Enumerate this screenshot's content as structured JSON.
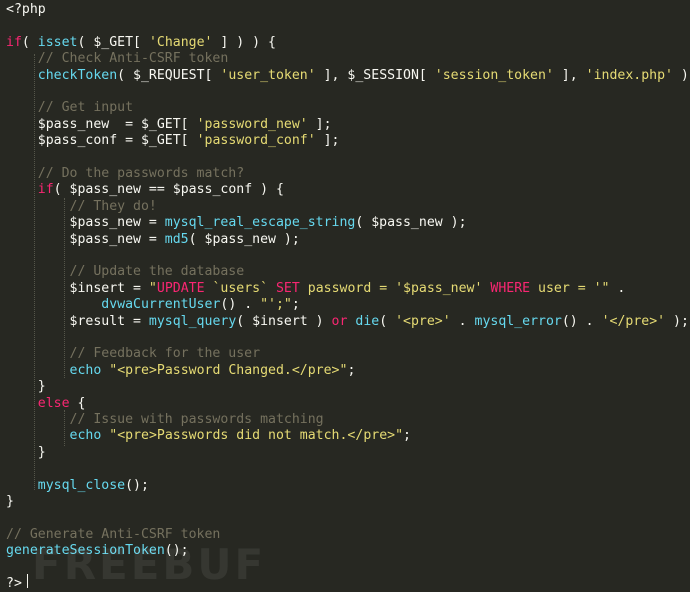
{
  "colors": {
    "background": "#272822",
    "default": "#f8f8f2",
    "keyword": "#f92672",
    "function": "#66d9ef",
    "string": "#e6db74",
    "comment": "#75715e"
  },
  "watermark": "FREEBUF",
  "lines": [
    [
      {
        "t": "<?php",
        "c": "default"
      }
    ],
    [],
    [
      {
        "t": "if",
        "c": "keyword"
      },
      {
        "t": "( ",
        "c": "default"
      },
      {
        "t": "isset",
        "c": "func"
      },
      {
        "t": "( $_GET[ ",
        "c": "default"
      },
      {
        "t": "'Change'",
        "c": "string"
      },
      {
        "t": " ] ) ) {",
        "c": "default"
      }
    ],
    [
      {
        "t": "    // Check Anti-CSRF token",
        "c": "comment"
      }
    ],
    [
      {
        "t": "    ",
        "c": "default"
      },
      {
        "t": "checkToken",
        "c": "func"
      },
      {
        "t": "( $_REQUEST[ ",
        "c": "default"
      },
      {
        "t": "'user_token'",
        "c": "string"
      },
      {
        "t": " ], $_SESSION[ ",
        "c": "default"
      },
      {
        "t": "'session_token'",
        "c": "string"
      },
      {
        "t": " ], ",
        "c": "default"
      },
      {
        "t": "'index.php'",
        "c": "string"
      },
      {
        "t": " );",
        "c": "default"
      }
    ],
    [],
    [
      {
        "t": "    // Get input",
        "c": "comment"
      }
    ],
    [
      {
        "t": "    $pass_new  = $_GET[ ",
        "c": "default"
      },
      {
        "t": "'password_new'",
        "c": "string"
      },
      {
        "t": " ];",
        "c": "default"
      }
    ],
    [
      {
        "t": "    $pass_conf = $_GET[ ",
        "c": "default"
      },
      {
        "t": "'password_conf'",
        "c": "string"
      },
      {
        "t": " ];",
        "c": "default"
      }
    ],
    [],
    [
      {
        "t": "    // Do the passwords match?",
        "c": "comment"
      }
    ],
    [
      {
        "t": "    ",
        "c": "default"
      },
      {
        "t": "if",
        "c": "keyword"
      },
      {
        "t": "( $pass_new == $pass_conf ) {",
        "c": "default"
      }
    ],
    [
      {
        "t": "        // They do!",
        "c": "comment"
      }
    ],
    [
      {
        "t": "        $pass_new = ",
        "c": "default"
      },
      {
        "t": "mysql_real_escape_string",
        "c": "func"
      },
      {
        "t": "( $pass_new );",
        "c": "default"
      }
    ],
    [
      {
        "t": "        $pass_new = ",
        "c": "default"
      },
      {
        "t": "md5",
        "c": "func"
      },
      {
        "t": "( $pass_new );",
        "c": "default"
      }
    ],
    [],
    [
      {
        "t": "        // Update the database",
        "c": "comment"
      }
    ],
    [
      {
        "t": "        $insert = ",
        "c": "default"
      },
      {
        "t": "\"",
        "c": "string"
      },
      {
        "t": "UPDATE",
        "c": "keyword"
      },
      {
        "t": " `users` ",
        "c": "string"
      },
      {
        "t": "SET",
        "c": "keyword"
      },
      {
        "t": " password = '$pass_new' ",
        "c": "string"
      },
      {
        "t": "WHERE",
        "c": "keyword"
      },
      {
        "t": " user = '\"",
        "c": "string"
      },
      {
        "t": " .",
        "c": "default"
      }
    ],
    [
      {
        "t": "            ",
        "c": "default"
      },
      {
        "t": "dvwaCurrentUser",
        "c": "func"
      },
      {
        "t": "() . ",
        "c": "default"
      },
      {
        "t": "\"';\"",
        "c": "string"
      },
      {
        "t": ";",
        "c": "default"
      }
    ],
    [
      {
        "t": "        $result = ",
        "c": "default"
      },
      {
        "t": "mysql_query",
        "c": "func"
      },
      {
        "t": "( $insert ) ",
        "c": "default"
      },
      {
        "t": "or",
        "c": "keyword"
      },
      {
        "t": " ",
        "c": "default"
      },
      {
        "t": "die",
        "c": "func"
      },
      {
        "t": "( ",
        "c": "default"
      },
      {
        "t": "'<pre>'",
        "c": "string"
      },
      {
        "t": " . ",
        "c": "default"
      },
      {
        "t": "mysql_error",
        "c": "func"
      },
      {
        "t": "() . ",
        "c": "default"
      },
      {
        "t": "'</pre>'",
        "c": "string"
      },
      {
        "t": " );",
        "c": "default"
      }
    ],
    [],
    [
      {
        "t": "        // Feedback for the user",
        "c": "comment"
      }
    ],
    [
      {
        "t": "        ",
        "c": "default"
      },
      {
        "t": "echo",
        "c": "func"
      },
      {
        "t": " ",
        "c": "default"
      },
      {
        "t": "\"<pre>Password Changed.</pre>\"",
        "c": "string"
      },
      {
        "t": ";",
        "c": "default"
      }
    ],
    [
      {
        "t": "    }",
        "c": "default"
      }
    ],
    [
      {
        "t": "    ",
        "c": "default"
      },
      {
        "t": "else",
        "c": "keyword"
      },
      {
        "t": " {",
        "c": "default"
      }
    ],
    [
      {
        "t": "        // Issue with passwords matching",
        "c": "comment"
      }
    ],
    [
      {
        "t": "        ",
        "c": "default"
      },
      {
        "t": "echo",
        "c": "func"
      },
      {
        "t": " ",
        "c": "default"
      },
      {
        "t": "\"<pre>Passwords did not match.</pre>\"",
        "c": "string"
      },
      {
        "t": ";",
        "c": "default"
      }
    ],
    [
      {
        "t": "    }",
        "c": "default"
      }
    ],
    [],
    [
      {
        "t": "    ",
        "c": "default"
      },
      {
        "t": "mysql_close",
        "c": "func"
      },
      {
        "t": "();",
        "c": "default"
      }
    ],
    [
      {
        "t": "}",
        "c": "default"
      }
    ],
    [],
    [
      {
        "t": "// Generate Anti-CSRF token",
        "c": "comment"
      }
    ],
    [
      {
        "t": "generateSessionToken",
        "c": "func"
      },
      {
        "t": "();",
        "c": "default"
      }
    ],
    [],
    [
      {
        "t": "?>",
        "c": "default"
      }
    ]
  ]
}
